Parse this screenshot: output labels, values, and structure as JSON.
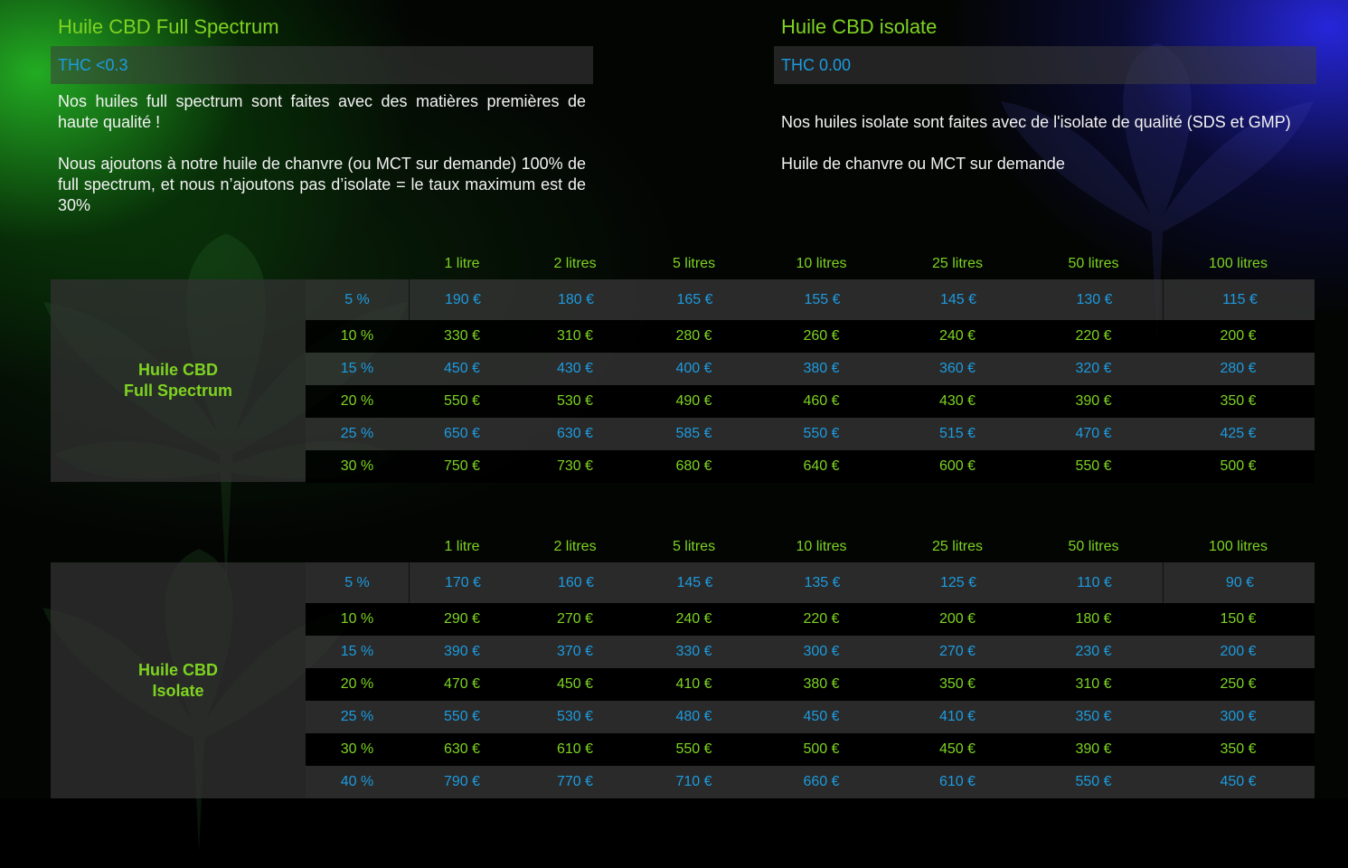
{
  "columns": [
    {
      "title": "Huile CBD Full Spectrum",
      "thc": "THC <0.3",
      "paragraphs": [
        "Nos huiles full spectrum sont faites avec des matières premières de haute qualité !",
        "Nous ajoutons à notre huile de chanvre (ou MCT sur demande) 100% de full spectrum, et nous n’ajoutons pas d’isolate = le taux maximum est de 30%"
      ]
    },
    {
      "title": "Huile CBD isolate",
      "thc": "THC 0.00",
      "paragraphs": [
        "Nos huiles isolate sont faites avec de l'isolate de qualité (SDS et GMP)",
        "Huile de chanvre ou MCT sur demande"
      ]
    }
  ],
  "sizes": [
    "1 litre",
    "2 litres",
    "5 litres",
    "10 litres",
    "25 litres",
    "50 litres",
    "100 litres"
  ],
  "tables": [
    {
      "label_line1": "Huile CBD",
      "label_line2": "Full Spectrum",
      "rows": [
        {
          "pct": "5 %",
          "prices": [
            "190 €",
            "180 €",
            "165 €",
            "155 €",
            "145 €",
            "130 €",
            "115 €"
          ]
        },
        {
          "pct": "10 %",
          "prices": [
            "330 €",
            "310 €",
            "280 €",
            "260 €",
            "240 €",
            "220 €",
            "200 €"
          ]
        },
        {
          "pct": "15 %",
          "prices": [
            "450 €",
            "430 €",
            "400 €",
            "380 €",
            "360 €",
            "320 €",
            "280 €"
          ]
        },
        {
          "pct": "20 %",
          "prices": [
            "550 €",
            "530 €",
            "490 €",
            "460 €",
            "430 €",
            "390 €",
            "350 €"
          ]
        },
        {
          "pct": "25 %",
          "prices": [
            "650 €",
            "630 €",
            "585 €",
            "550 €",
            "515 €",
            "470 €",
            "425 €"
          ]
        },
        {
          "pct": "30 %",
          "prices": [
            "750 €",
            "730 €",
            "680 €",
            "640 €",
            "600 €",
            "550 €",
            "500 €"
          ]
        }
      ]
    },
    {
      "label_line1": "Huile CBD",
      "label_line2": "Isolate",
      "rows": [
        {
          "pct": "5 %",
          "prices": [
            "170 €",
            "160 €",
            "145 €",
            "135 €",
            "125 €",
            "110 €",
            "90 €"
          ]
        },
        {
          "pct": "10 %",
          "prices": [
            "290 €",
            "270 €",
            "240 €",
            "220 €",
            "200 €",
            "180 €",
            "150 €"
          ]
        },
        {
          "pct": "15 %",
          "prices": [
            "390 €",
            "370 €",
            "330 €",
            "300 €",
            "270 €",
            "230 €",
            "200 €"
          ]
        },
        {
          "pct": "20 %",
          "prices": [
            "470 €",
            "450 €",
            "410 €",
            "380 €",
            "350 €",
            "310 €",
            "250 €"
          ]
        },
        {
          "pct": "25 %",
          "prices": [
            "550 €",
            "530 €",
            "480 €",
            "450 €",
            "410 €",
            "350 €",
            "300 €"
          ]
        },
        {
          "pct": "30 %",
          "prices": [
            "630 €",
            "610 €",
            "550 €",
            "500 €",
            "450 €",
            "390 €",
            "350 €"
          ]
        },
        {
          "pct": "40 %",
          "prices": [
            "790 €",
            "770 €",
            "710 €",
            "660 €",
            "610 €",
            "550 €",
            "450 €"
          ]
        }
      ]
    }
  ]
}
